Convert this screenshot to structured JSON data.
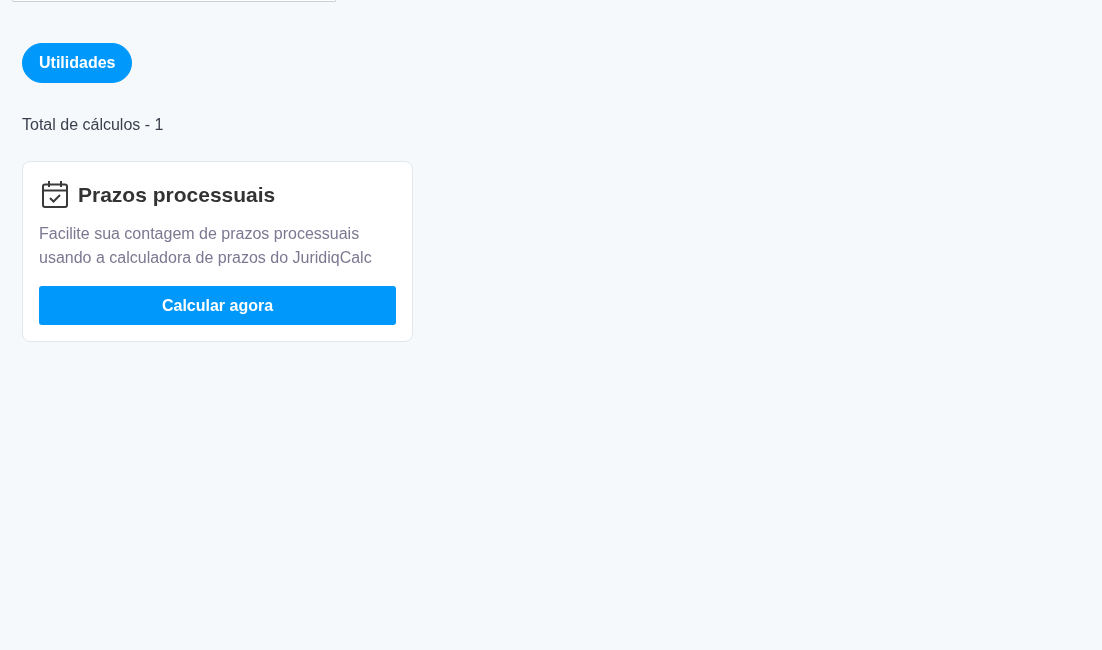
{
  "categories": [
    {
      "label": "Utilidades",
      "selected": true
    }
  ],
  "total_label": "Total de cálculos - 1",
  "cards": [
    {
      "title": "Prazos processuais",
      "description": "Facilite sua contagem de prazos processuais usando a calculadora de prazos do JuridiqCalc",
      "button": "Calcular agora"
    }
  ]
}
